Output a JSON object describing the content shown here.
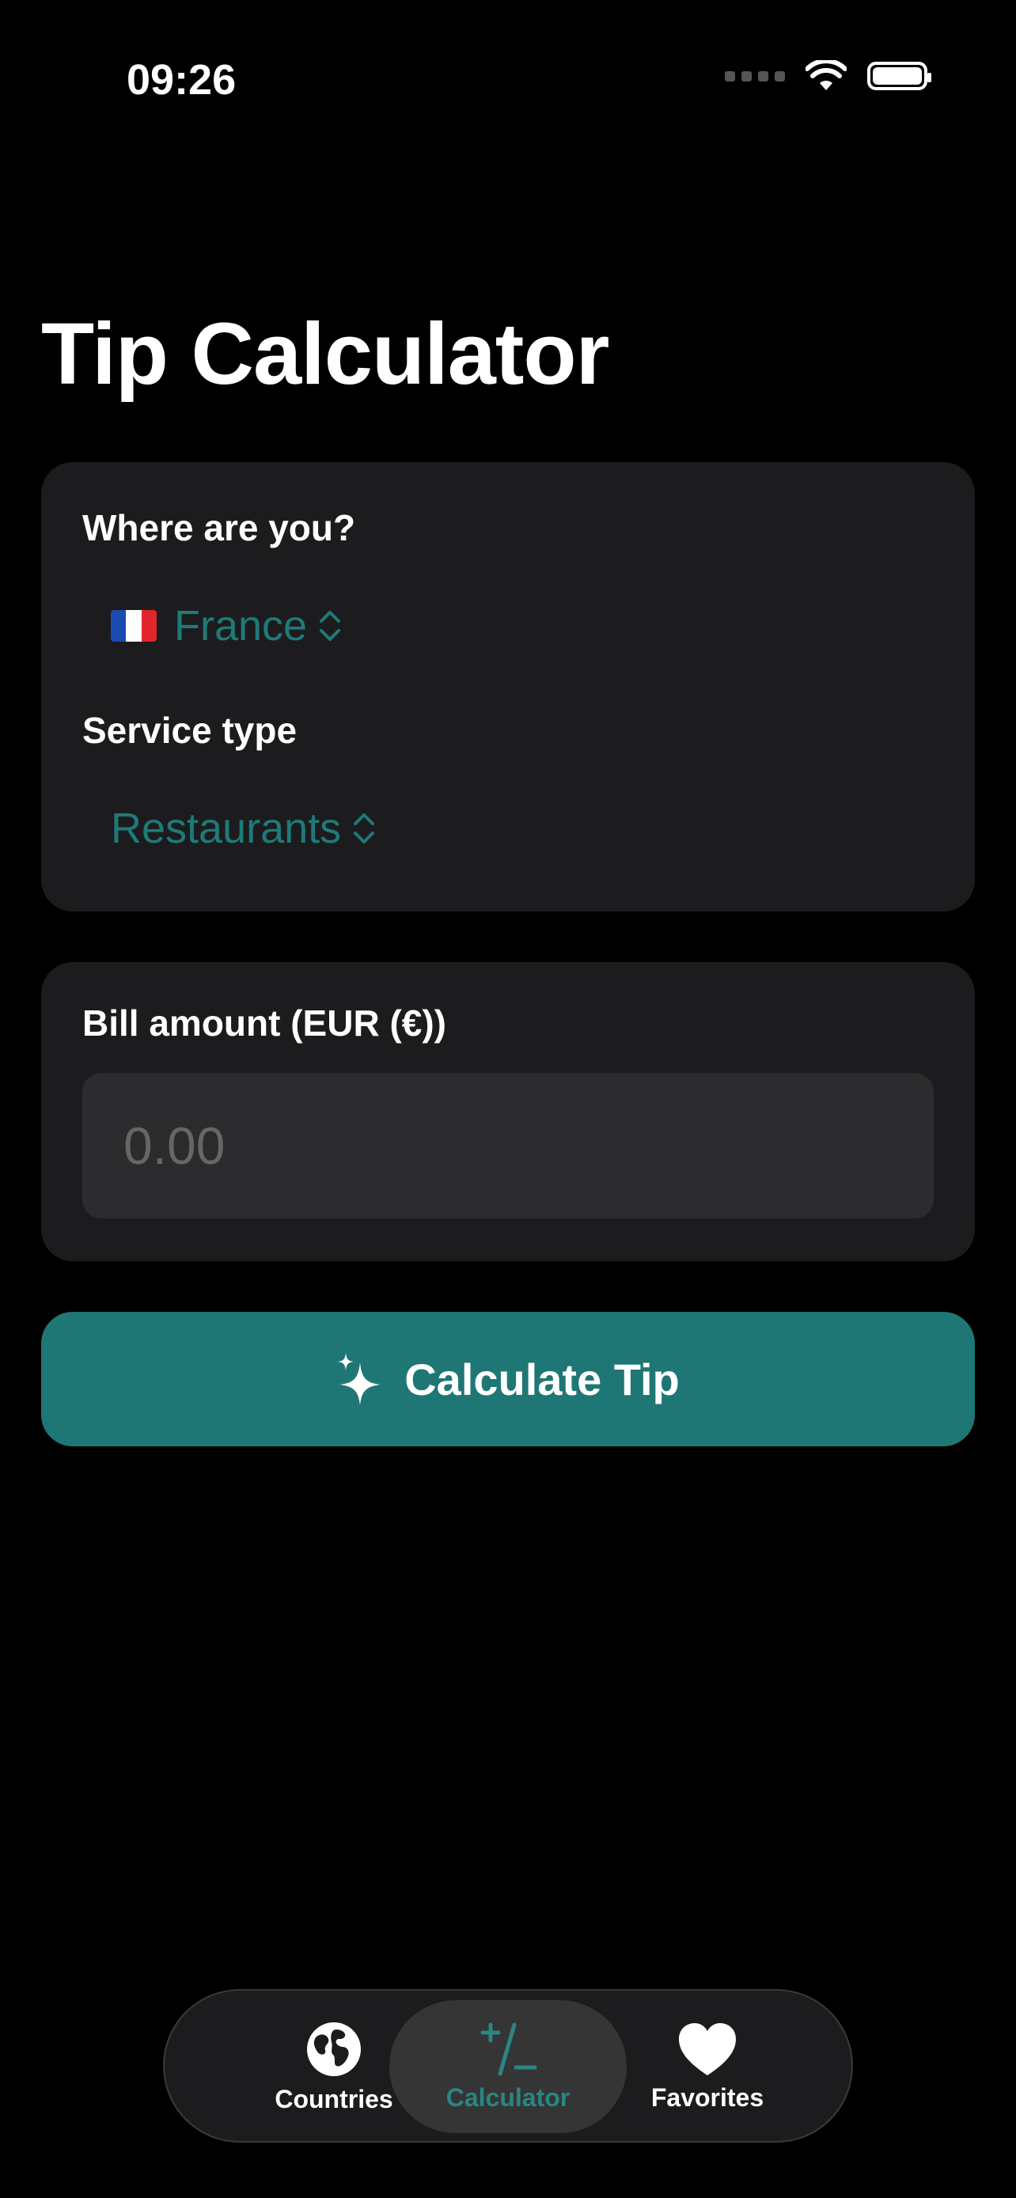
{
  "status_bar": {
    "time": "09:26"
  },
  "page": {
    "title": "Tip Calculator"
  },
  "location_card": {
    "location_label": "Where are you?",
    "country": "France",
    "service_label": "Service type",
    "service": "Restaurants"
  },
  "bill_card": {
    "label": "Bill amount (EUR (€))",
    "placeholder": "0.00"
  },
  "calculate_button": {
    "label": "Calculate Tip"
  },
  "tab_bar": {
    "countries": "Countries",
    "calculator": "Calculator",
    "favorites": "Favorites",
    "selected": "Calculator"
  },
  "colors": {
    "accent": "#1f7a78",
    "button": "#1f7775",
    "card": "#1c1c1e",
    "input": "#2c2c2e",
    "background": "#000000"
  },
  "icons": {
    "country_flag": "flag-france-icon",
    "picker": "chevron-up-down-icon",
    "calculate": "sparkles-icon",
    "countries_tab": "globe-icon",
    "calculator_tab": "plus-slash-minus-icon",
    "favorites_tab": "heart-icon"
  }
}
